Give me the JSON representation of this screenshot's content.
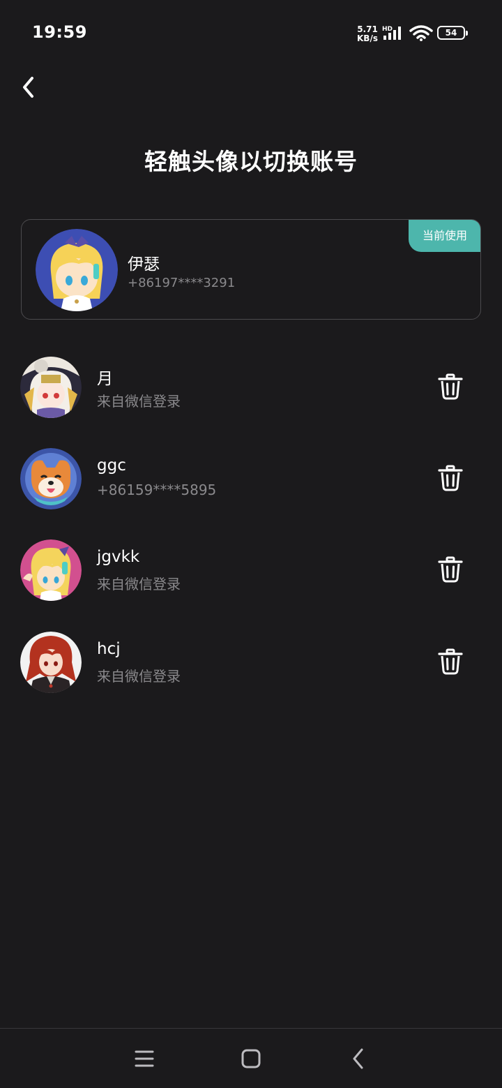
{
  "status_bar": {
    "time": "19:59",
    "net_speed_value": "5.71",
    "net_speed_unit": "KB/s",
    "network_type": "HD",
    "battery": "54"
  },
  "header": {
    "back_icon": "chevron-left-icon",
    "title": "轻触头像以切换账号"
  },
  "current_account": {
    "badge": "当前使用",
    "name": "伊瑟",
    "phone": "+86197****3291"
  },
  "accounts": [
    {
      "name": "月",
      "subtitle": "来自微信登录",
      "action_icon": "trash-icon"
    },
    {
      "name": "ggc",
      "subtitle": "+86159****5895",
      "action_icon": "trash-icon"
    },
    {
      "name": "jgvkk",
      "subtitle": "来自微信登录",
      "action_icon": "trash-icon"
    },
    {
      "name": "hcj",
      "subtitle": "来自微信登录",
      "action_icon": "trash-icon"
    }
  ],
  "nav": {
    "menu_icon": "menu-icon",
    "home_icon": "home-square-icon",
    "back_icon": "back-arrow-icon"
  },
  "colors": {
    "background": "#1b1a1c",
    "accent": "#4db6ac",
    "secondary_text": "#8a898c"
  }
}
